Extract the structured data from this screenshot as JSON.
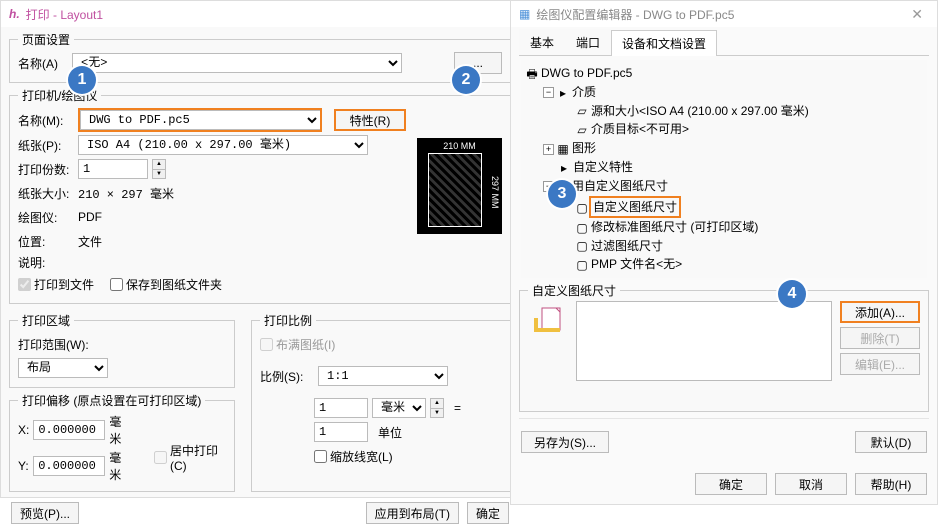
{
  "print_window": {
    "title": "打印 - Layout1",
    "page_setup": {
      "legend": "页面设置",
      "name_label": "名称(A)",
      "name_value": "<无>",
      "btn_dots": "..."
    },
    "printer": {
      "legend": "打印机/绘图仪",
      "name_label": "名称(M):",
      "name_value": "DWG to PDF.pc5",
      "prop_btn": "特性(R)",
      "paper_label": "纸张(P):",
      "paper_value": "ISO A4 (210.00 x 297.00 毫米)",
      "copies_label": "打印份数:",
      "copies_value": "1",
      "papersize_label": "纸张大小:",
      "papersize_value": "210 × 297 毫米",
      "plotter_label": "绘图仪:",
      "plotter_value": "PDF",
      "location_label": "位置:",
      "location_value": "文件",
      "desc_label": "说明:",
      "to_file_label": "打印到文件",
      "save_folder_label": "保存到图纸文件夹",
      "preview": {
        "width": "210 MM",
        "height": "297 MM"
      }
    },
    "area": {
      "legend": "打印区域",
      "range_label": "打印范围(W):",
      "range_value": "布局"
    },
    "offset": {
      "legend": "打印偏移 (原点设置在可打印区域)",
      "x_label": "X:",
      "x_value": "0.000000",
      "x_unit": "毫米",
      "y_label": "Y:",
      "y_value": "0.000000",
      "y_unit": "毫米",
      "center_label": "居中打印(C)"
    },
    "scale": {
      "legend": "打印比例",
      "fit_label": "布满图纸(I)",
      "ratio_label": "比例(S):",
      "ratio_value": "1:1",
      "unit_top_value": "1",
      "unit_top_sel": "毫米",
      "eq": "=",
      "unit_bot_value": "1",
      "unit_bot_label": "单位",
      "scale_lw_label": "缩放线宽(L)"
    },
    "buttons": {
      "preview": "预览(P)...",
      "apply": "应用到布局(T)",
      "ok": "确定"
    }
  },
  "plotter_window": {
    "title": "绘图仪配置编辑器 - DWG to PDF.pc5",
    "tabs": {
      "basic": "基本",
      "port": "端口",
      "device": "设备和文档设置"
    },
    "tree": {
      "root": "DWG to PDF.pc5",
      "media": "介质",
      "media_src": "源和大小<ISO A4 (210.00 x 297.00 毫米)",
      "media_target": "介质目标<不可用>",
      "graphics": "图形",
      "custom_props": "自定义特性",
      "user_paper": "用自定义图纸尺寸",
      "custom_paper": "自定义图纸尺寸",
      "modify_std": "修改标准图纸尺寸 (可打印区域)",
      "filter_paper": "过滤图纸尺寸",
      "pmp": "PMP 文件名<无>"
    },
    "custom_group": {
      "legend": "自定义图纸尺寸",
      "add_btn": "添加(A)...",
      "del_btn": "删除(T)",
      "edit_btn": "编辑(E)..."
    },
    "buttons": {
      "save_as": "另存为(S)...",
      "default": "默认(D)",
      "ok": "确定",
      "cancel": "取消",
      "help": "帮助(H)"
    },
    "badges": {
      "b1": "1",
      "b2": "2",
      "b3": "3",
      "b4": "4"
    }
  }
}
